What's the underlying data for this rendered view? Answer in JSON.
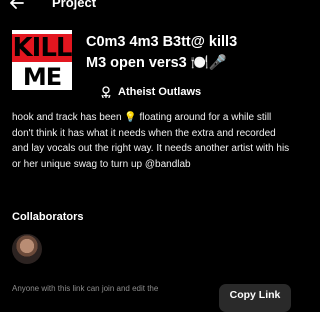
{
  "header": {
    "title": "Project",
    "back_icon": "arrow-left-icon"
  },
  "cover": {
    "line1": "KILL",
    "line2": "ME",
    "colors": {
      "accent": "#e3161f",
      "background": "#ffffff",
      "text": "#000000"
    }
  },
  "track": {
    "title_line1": "C0m3 4m3 B3tt@ kill3",
    "title_line2": "M3 open vers3 🍽️🎤",
    "artist_icon": "atheist-symbol-icon",
    "artist": "Atheist Outlaws"
  },
  "description": "hook and track has been 💡 floating around for a while still don't think it has what it needs when the extra and recorded and lay vocals out the right way. It needs another artist with his or her unique swag to turn up @bandlab",
  "collaborators": {
    "title": "Collaborators"
  },
  "footer": {
    "share_text": "Anyone with this link can join and edit the",
    "copy_link_label": "Copy Link"
  }
}
